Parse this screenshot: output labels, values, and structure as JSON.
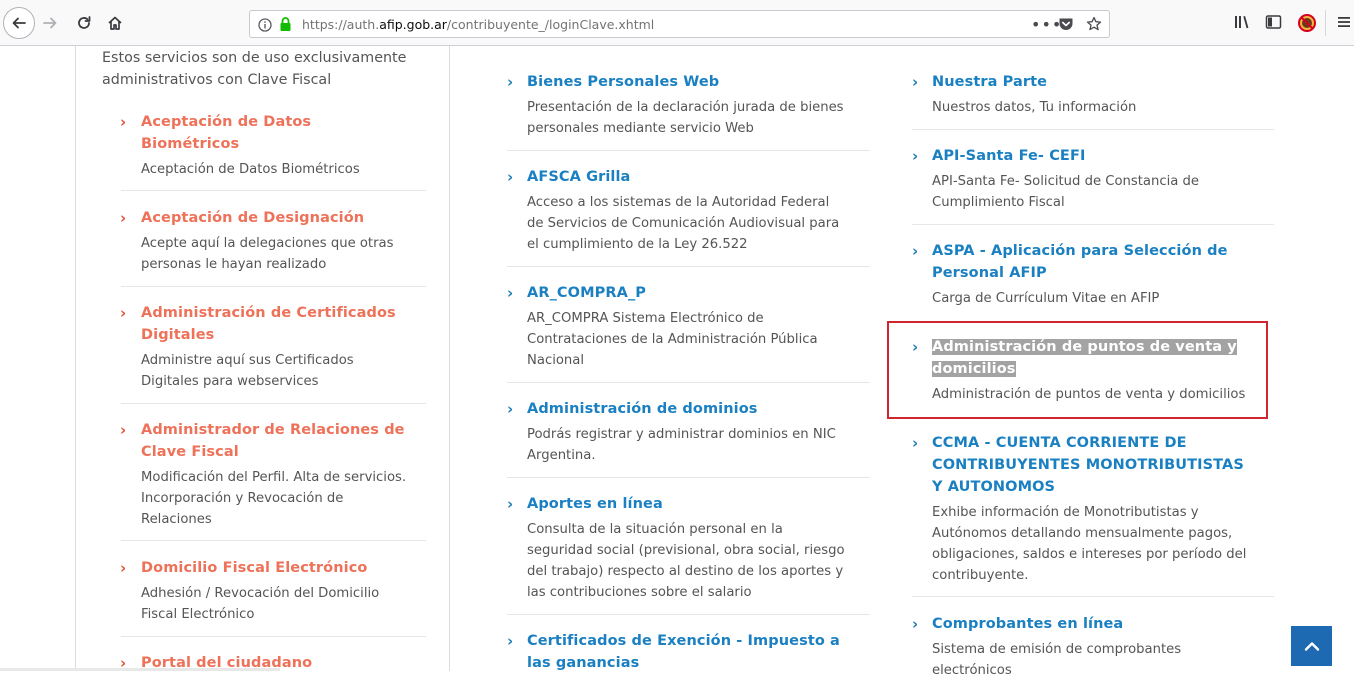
{
  "browser": {
    "url_prefix": "https://auth.",
    "url_domain": "afip.gob.ar",
    "url_path": "/contribuyente_/loginClave.xhtml",
    "url_more": "•••"
  },
  "left": {
    "intro": "Estos servicios son de uso exclusivamente administrativos con Clave Fiscal",
    "items": [
      {
        "title": "Aceptación de Datos Biométricos",
        "desc": "Aceptación de Datos Biométricos"
      },
      {
        "title": "Aceptación de Designación",
        "desc": "Acepte aquí la delegaciones que otras personas le hayan realizado"
      },
      {
        "title": "Administración de Certificados Digitales",
        "desc": "Administre aquí sus Certificados Digitales para webservices"
      },
      {
        "title": "Administrador de Relaciones de Clave Fiscal",
        "desc": "Modificación del Perfil. Alta de servicios. Incorporación y Revocación de Relaciones"
      },
      {
        "title": "Domicilio Fiscal Electrónico",
        "desc": "Adhesión / Revocación del Domicilio Fiscal Electrónico"
      },
      {
        "title": "Portal del ciudadano",
        "desc": ""
      }
    ]
  },
  "col2": {
    "items": [
      {
        "title": "Bienes Personales Web",
        "desc": "Presentación de la declaración jurada de bienes personales mediante servicio Web"
      },
      {
        "title": "AFSCA Grilla",
        "desc": "Acceso a los sistemas de la Autoridad Federal de Servicios de Comunicación Audiovisual para el cumplimiento de la Ley 26.522"
      },
      {
        "title": "AR_COMPRA_P",
        "desc": "AR_COMPRA Sistema Electrónico de Contrataciones de la Administración Pública Nacional"
      },
      {
        "title": "Administración de dominios",
        "desc": "Podrás registrar y administrar dominios en NIC Argentina."
      },
      {
        "title": "Aportes en línea",
        "desc": "Consulta de la situación personal en la seguridad social (previsional, obra social, riesgo del trabajo) respecto al destino de los aportes y las contribuciones sobre el salario"
      },
      {
        "title": "Certificados de Exención - Impuesto a las ganancias",
        "desc": ""
      }
    ]
  },
  "col3": {
    "items": [
      {
        "title": "Nuestra Parte",
        "desc": "Nuestros datos, Tu información"
      },
      {
        "title": "API-Santa Fe- CEFI",
        "desc": "API-Santa Fe- Solicitud de Constancia de Cumplimiento Fiscal"
      },
      {
        "title": "ASPA - Aplicación para Selección de Personal AFIP",
        "desc": "Carga de Currículum Vitae en AFIP"
      },
      {
        "title": "Administración de puntos de venta y domicilios",
        "desc": "Administración de puntos de venta y domicilios"
      },
      {
        "title": "CCMA - CUENTA CORRIENTE DE CONTRIBUYENTES MONOTRIBUTISTAS Y AUTONOMOS",
        "desc": "Exhibe información de Monotributistas y Autónomos detallando mensualmente pagos, obligaciones, saldos e intereses por período del contribuyente."
      },
      {
        "title": "Comprobantes en línea",
        "desc": "Sistema de emisión de comprobantes electrónicos"
      }
    ]
  },
  "colors": {
    "left_title": "#ee7259",
    "link_blue": "#1a80c2",
    "highlight_box": "#d0262f",
    "back_to_top": "#1d6ab3"
  },
  "icons": [
    "back-icon",
    "forward-icon",
    "reload-icon",
    "home-icon",
    "info-icon",
    "lock-icon",
    "pocket-icon",
    "star-icon",
    "library-icon",
    "sidebar-icon",
    "addon-blocked-icon",
    "menu-icon",
    "chevron-right-icon",
    "chevron-up-icon"
  ]
}
